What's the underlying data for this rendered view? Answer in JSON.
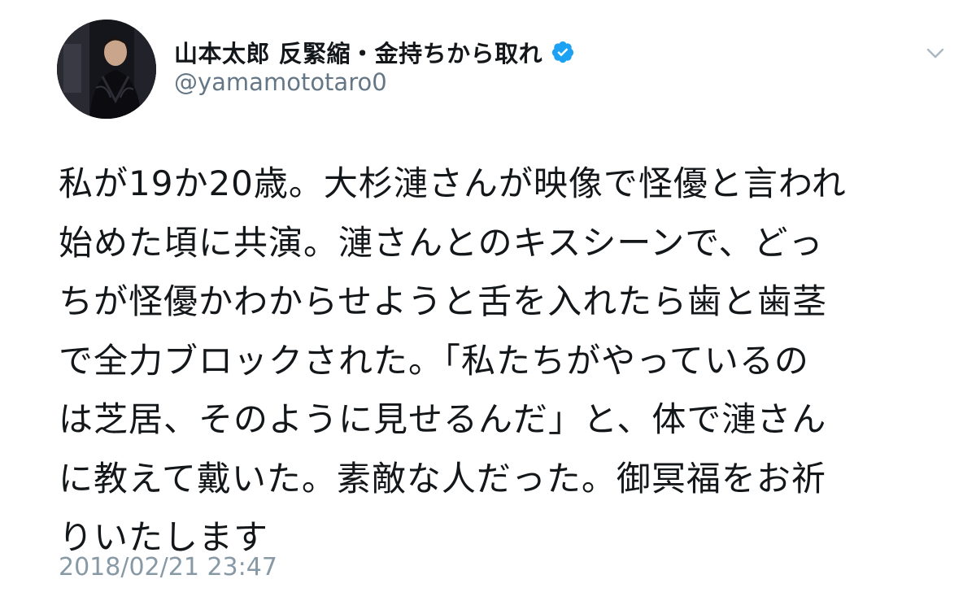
{
  "tweet": {
    "author": {
      "display_name": "山本太郎  反緊縮・金持ちから取れ",
      "handle": "@yamamototaro0",
      "verified": true
    },
    "text_lines": [
      "私が19か20歳。大杉漣さんが映像で怪優と言われ",
      "始めた頃に共演。漣さんとのキスシーンで、どっ",
      "ちが怪優かわからせようと舌を入れたら歯と歯茎",
      "で全力ブロックされた。「私たちがやっているの",
      "は芝居、そのように見せるんだ」と、体で漣さん",
      "に教えて戴いた。素敵な人だった。御冥福をお祈",
      "りいたします"
    ],
    "timestamp": "2018/02/21 23:47",
    "icons": {
      "verified": "verified-badge-icon",
      "menu": "chevron-down-icon"
    },
    "colors": {
      "verified_blue": "#1da1f2",
      "secondary_text": "#657786",
      "timestamp_text": "#8899a6",
      "primary_text": "#14171a"
    }
  }
}
